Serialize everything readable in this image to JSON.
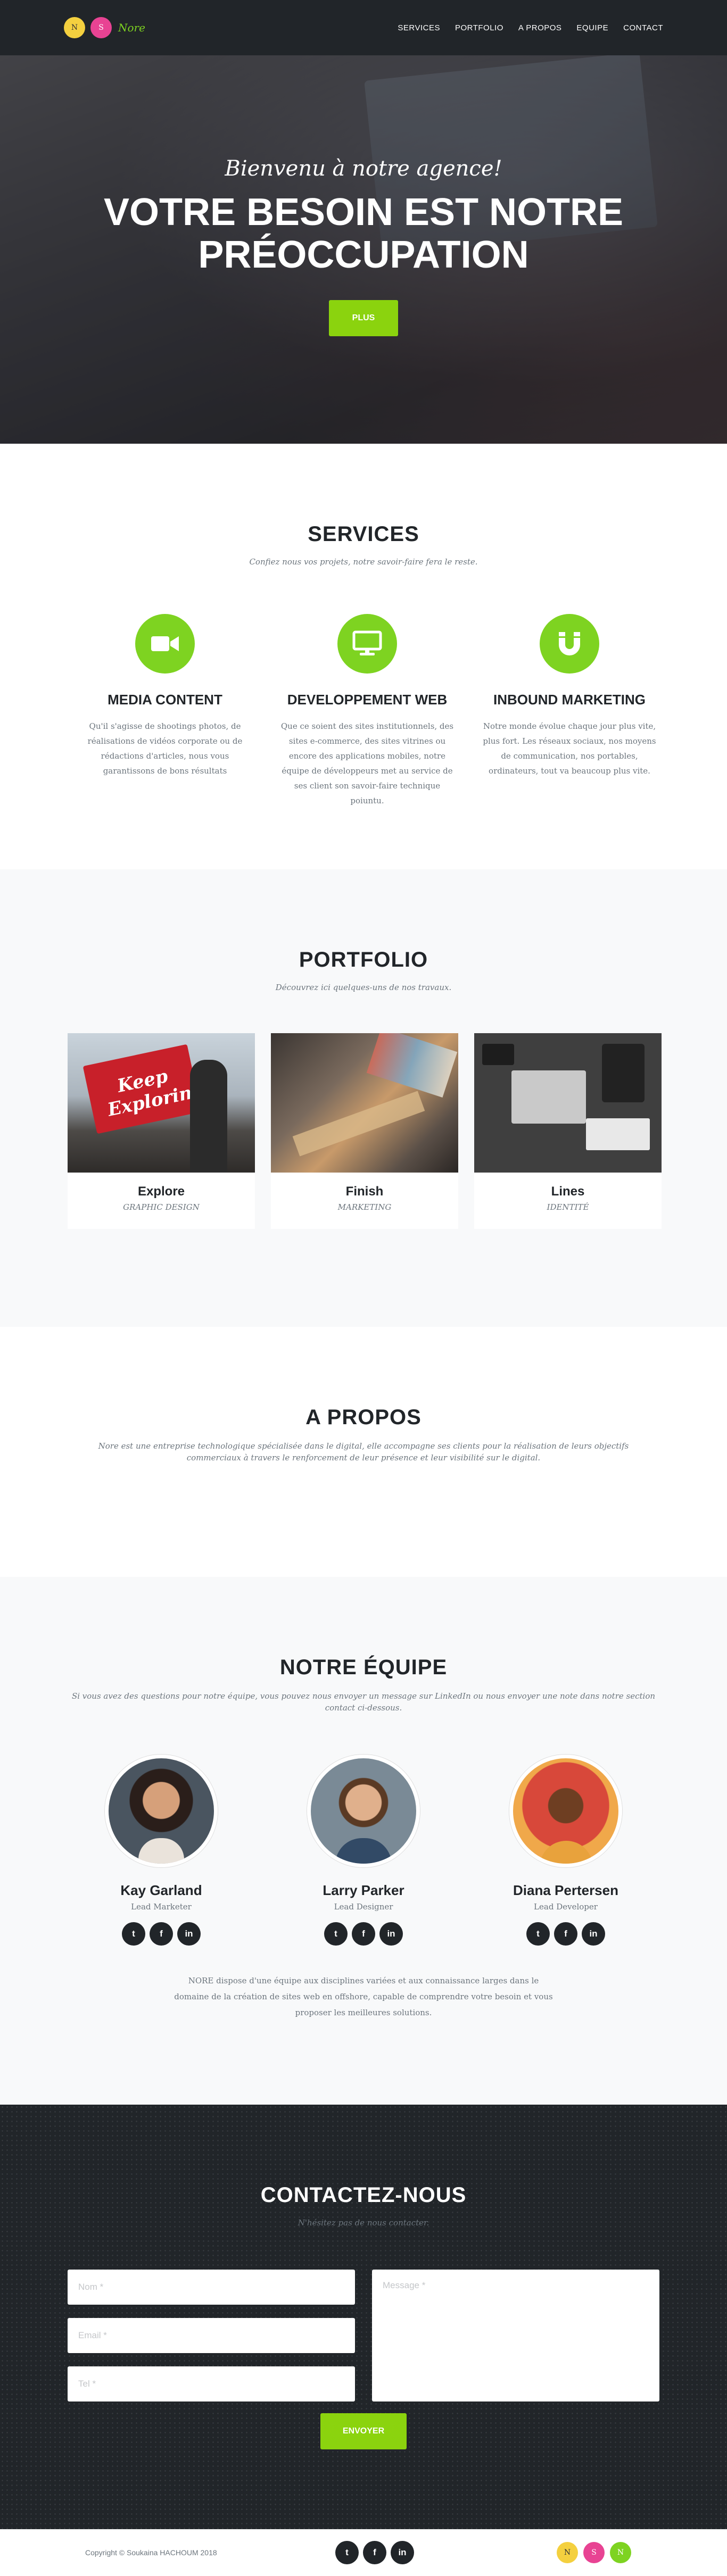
{
  "brand": {
    "logos": [
      {
        "letter": "N",
        "color": "#f4d03f"
      },
      {
        "letter": "S",
        "color": "#e84393"
      }
    ],
    "name": "Nore"
  },
  "nav": {
    "items": [
      "SERVICES",
      "PORTFOLIO",
      "A PROPOS",
      "EQUIPE",
      "CONTACT"
    ]
  },
  "hero": {
    "subtitle": "Bienvenu à notre agence!",
    "title": "VOTRE BESOIN EST NOTRE PRÉOCCUPATION",
    "button": "PLUS"
  },
  "services": {
    "title": "SERVICES",
    "subtitle": "Confiez nous vos projets, notre savoir-faire fera le reste.",
    "items": [
      {
        "icon": "video-camera-icon",
        "title": "MEDIA CONTENT",
        "text": "Qu'il s'agisse de shootings photos, de réalisations de vidéos corporate ou de rédactions d'articles, nous vous garantissons de bons résultats"
      },
      {
        "icon": "desktop-monitor-icon",
        "title": "DEVELOPPEMENT WEB",
        "text": "Que ce soient des sites institutionnels, des sites e-commerce, des sites vitrines ou encore des applications mobiles, notre équipe de développeurs met au service de ses client son savoir-faire technique poiuntu."
      },
      {
        "icon": "magnet-icon",
        "title": "INBOUND MARKETING",
        "text": "Notre monde évolue chaque jour plus vite, plus fort. Les réseaux sociaux, nos moyens de communication, nos portables, ordinateurs, tout va beaucoup plus vite."
      }
    ]
  },
  "portfolio": {
    "title": "PORTFOLIO",
    "subtitle": "Découvrez ici quelques-uns de nos travaux.",
    "items": [
      {
        "name": "Explore",
        "category": "GRAPHIC DESIGN",
        "sign_text": "Keep Exploring"
      },
      {
        "name": "Finish",
        "category": "MARKETING"
      },
      {
        "name": "Lines",
        "category": "IDENTITÉ"
      }
    ]
  },
  "about": {
    "title": "A PROPOS",
    "text": "Nore est une entreprise technologique spécialisée dans le digital, elle accompagne ses clients pour la réalisation de leurs objectifs commerciaux à travers le renforcement de leur présence et leur visibilité sur le digital."
  },
  "team": {
    "title": "NOTRE ÉQUIPE",
    "subtitle": "Si vous avez des questions pour notre équipe, vous pouvez nous envoyer un message sur LinkedIn ou nous envoyer une note dans notre section contact ci-dessous.",
    "members": [
      {
        "name": "Kay Garland",
        "role": "Lead Marketer",
        "photo": "woman-glasses-photo"
      },
      {
        "name": "Larry Parker",
        "role": "Lead Designer",
        "photo": "man-beard-photo"
      },
      {
        "name": "Diana Pertersen",
        "role": "Lead Developer",
        "photo": "woman-colorful-photo"
      }
    ],
    "social": [
      "twitter-icon",
      "facebook-icon",
      "linkedin-icon"
    ],
    "note": "NORE dispose d'une équipe aux disciplines variées et aux connaissance larges dans le domaine de la création de sites web en offshore, capable de comprendre votre besoin et vous proposer les meilleures solutions."
  },
  "contact": {
    "title": "CONTACTEZ-NOUS",
    "subtitle": "N'hésitez pas de nous contacter.",
    "fields": {
      "name_placeholder": "Nom *",
      "email_placeholder": "Email *",
      "tel_placeholder": "Tel *",
      "message_placeholder": "Message *"
    },
    "button": "ENVOYER"
  },
  "footer": {
    "copyright": "Copyright © Soukaina HACHOUM 2018",
    "logos": [
      {
        "letter": "N",
        "color": "#f4d03f"
      },
      {
        "letter": "S",
        "color": "#e84393"
      },
      {
        "letter": "N",
        "color": "#7ed321"
      }
    ]
  },
  "colors": {
    "accent": "#8bd30e",
    "dark": "#212529",
    "light_bg": "#f8f9fa"
  }
}
